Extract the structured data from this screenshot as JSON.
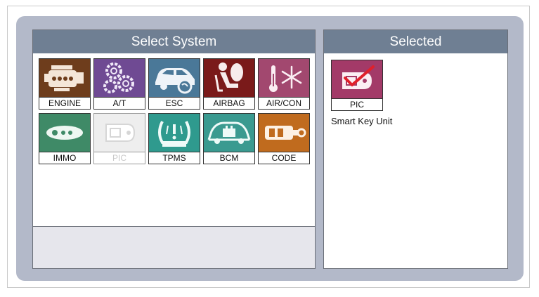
{
  "left_panel": {
    "title": "Select System"
  },
  "right_panel": {
    "title": "Selected"
  },
  "systems": [
    {
      "label": "ENGINE",
      "icon": "engine-icon",
      "color": "#6e3d1c",
      "enabled": true
    },
    {
      "label": "A/T",
      "icon": "gears-icon",
      "color": "#6f4a93",
      "enabled": true
    },
    {
      "label": "ESC",
      "icon": "car-wheel-icon",
      "color": "#4a7898",
      "enabled": true
    },
    {
      "label": "AIRBAG",
      "icon": "airbag-seat-icon",
      "color": "#7a1a1a",
      "enabled": true
    },
    {
      "label": "AIR/CON",
      "icon": "thermometer-snowflake-icon",
      "color": "#a2486f",
      "enabled": true
    },
    {
      "label": "IMMO",
      "icon": "key-icon",
      "color": "#3f8a67",
      "enabled": true
    },
    {
      "label": "PIC",
      "icon": "smart-key-icon",
      "color": "#eeeeee",
      "enabled": false
    },
    {
      "label": "TPMS",
      "icon": "tire-pressure-icon",
      "color": "#2f9a8e",
      "enabled": true
    },
    {
      "label": "BCM",
      "icon": "car-body-icon",
      "color": "#3a9a90",
      "enabled": true
    },
    {
      "label": "CODE",
      "icon": "key-fob-icon",
      "color": "#c06b1e",
      "enabled": true
    }
  ],
  "selected": {
    "label": "PIC",
    "icon": "smart-key-checked-icon",
    "color": "#a33a68",
    "check_color": "#e0202a",
    "description": "Smart Key Unit"
  }
}
